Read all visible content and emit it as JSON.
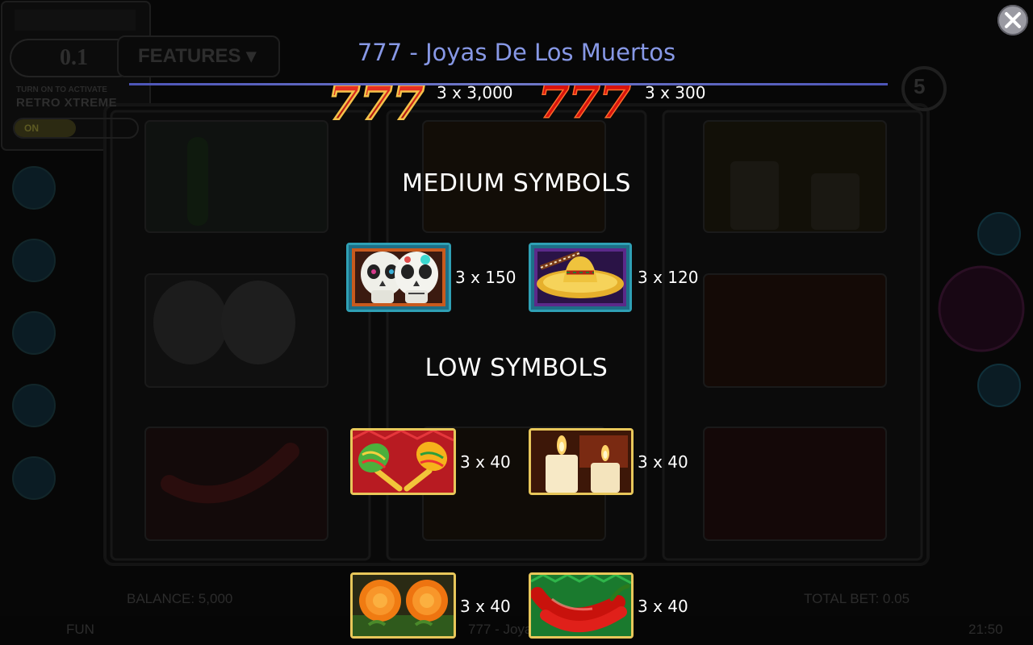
{
  "game_title": "777 - Joyas De Los Muertos",
  "close_icon": "close-icon",
  "background": {
    "bet_value": "0.1",
    "features_label": "FEATURES",
    "turn_on_hint": "TURN ON TO ACTIVATE",
    "retro_label": "RETRO XTREME",
    "toggle_label": "ON",
    "balance_text": "BALANCE: 5,000",
    "total_bet_text": "TOTAL BET: 0.05",
    "mode_text": "FUN",
    "game_name_footer": "777 - Joyas De...",
    "clock_text": "21:50",
    "counter_text": "5"
  },
  "paytable": {
    "top_symbols": [
      {
        "name": "seven-gold",
        "payout": "3 x 3,000"
      },
      {
        "name": "seven-red",
        "payout": "3 x 300"
      }
    ],
    "medium_heading": "MEDIUM SYMBOLS",
    "medium_symbols": [
      {
        "name": "sugar-skulls",
        "payout": "3 x 150"
      },
      {
        "name": "sombrero",
        "payout": "3 x 120"
      }
    ],
    "low_heading": "LOW SYMBOLS",
    "low_symbols": [
      {
        "name": "maracas",
        "payout": "3 x 40"
      },
      {
        "name": "candles",
        "payout": "3 x 40"
      },
      {
        "name": "marigolds",
        "payout": "3 x 40"
      },
      {
        "name": "chili-peppers",
        "payout": "3 x 40"
      }
    ]
  },
  "colors": {
    "title": "#8798e6",
    "rule": "#5a62bf",
    "medium_frame": "#2fa0b5",
    "low_frame": "#e8c75a"
  }
}
